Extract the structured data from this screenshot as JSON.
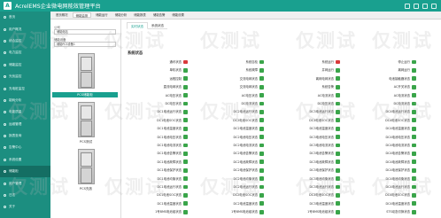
{
  "header": {
    "logo_text": "A",
    "title": "AcrelEMS企业微电网能效管理平台"
  },
  "sidebar": {
    "items": [
      {
        "label": "首页"
      },
      {
        "label": "用户概况"
      },
      {
        "label": "综合监控"
      },
      {
        "label": "电力监控"
      },
      {
        "label": "储能监控"
      },
      {
        "label": "光伏监控"
      },
      {
        "label": "充电桩监控"
      },
      {
        "label": "能耗分析"
      },
      {
        "label": "电能质量"
      },
      {
        "label": "运维管理"
      },
      {
        "label": "报表查询"
      },
      {
        "label": "告警中心"
      },
      {
        "label": "系统设置"
      },
      {
        "label": "储能柜",
        "active": true
      },
      {
        "label": "用户管理"
      },
      {
        "label": "日志"
      },
      {
        "label": "关于"
      }
    ]
  },
  "toolbar": {
    "tabs": [
      {
        "label": "首页概况"
      },
      {
        "label": "储能监测"
      },
      {
        "label": "储能运行"
      },
      {
        "label": "储能分析"
      },
      {
        "label": "储能报表"
      },
      {
        "label": "储能告警"
      },
      {
        "label": "储能设置"
      }
    ]
  },
  "tree": {
    "label1": "公司",
    "value1": "储能电站",
    "label2": "储能设备",
    "value2": "储能PCS设备1",
    "cabinets": [
      "PCS储能柜",
      "PCS测试",
      "PCS充放"
    ]
  },
  "subtabs": [
    "实时状态",
    "系统状态"
  ],
  "section_title": "系统状态",
  "status_rows": [
    [
      {
        "label": "通讯状态",
        "color": "red"
      },
      {
        "label": "系统自检",
        "color": "green"
      },
      {
        "label": "系统运行",
        "color": "red"
      },
      {
        "label": "停止运行",
        "color": "green"
      }
    ],
    [
      {
        "label": "单机状态",
        "color": "green"
      },
      {
        "label": "系统故障",
        "color": "green"
      },
      {
        "label": "并网运行",
        "color": "green"
      },
      {
        "label": "离网运行",
        "color": "green"
      }
    ],
    [
      {
        "label": "远程控制",
        "color": "green"
      },
      {
        "label": "交流电网状态",
        "color": "green"
      },
      {
        "label": "离网电网状态",
        "color": "green"
      },
      {
        "label": "电池接触器状态",
        "color": "green"
      }
    ],
    [
      {
        "label": "直流电网状态",
        "color": "green"
      },
      {
        "label": "交流电网状态",
        "color": "green"
      },
      {
        "label": "系统告警",
        "color": "green"
      },
      {
        "label": "AC开关状态",
        "color": "green"
      }
    ],
    [
      {
        "label": "AC电压状态",
        "color": "green"
      },
      {
        "label": "AC电压状态",
        "color": "green"
      },
      {
        "label": "AC电流状态",
        "color": "green"
      },
      {
        "label": "AC电流状态",
        "color": "green"
      }
    ],
    [
      {
        "label": "DC电压状态",
        "color": "green"
      },
      {
        "label": "DC电流状态",
        "color": "green"
      },
      {
        "label": "DC电压状态",
        "color": "green"
      },
      {
        "label": "DC电流状态",
        "color": "green"
      }
    ],
    [
      {
        "label": "DC1电池运行状态",
        "color": "green"
      },
      {
        "label": "DC2电池运行状态",
        "color": "green"
      },
      {
        "label": "DC3电池运行状态",
        "color": "green"
      },
      {
        "label": "DC4电池运行状态",
        "color": "green"
      }
    ],
    [
      {
        "label": "DC1电池SOC状态",
        "color": "green"
      },
      {
        "label": "DC2电池SOC状态",
        "color": "green"
      },
      {
        "label": "DC3电池SOC状态",
        "color": "green"
      },
      {
        "label": "DC4电池SOC状态",
        "color": "green"
      }
    ],
    [
      {
        "label": "DC1电池温度状态",
        "color": "green"
      },
      {
        "label": "DC2电池温度状态",
        "color": "green"
      },
      {
        "label": "DC3电池温度状态",
        "color": "green"
      },
      {
        "label": "DC4电池温度状态",
        "color": "green"
      }
    ],
    [
      {
        "label": "DC1电池电压状态",
        "color": "green"
      },
      {
        "label": "DC2电池电压状态",
        "color": "green"
      },
      {
        "label": "DC3电池电压状态",
        "color": "green"
      },
      {
        "label": "DC4电池电压状态",
        "color": "green"
      }
    ],
    [
      {
        "label": "DC1电池电流状态",
        "color": "green"
      },
      {
        "label": "DC2电池电流状态",
        "color": "green"
      },
      {
        "label": "DC3电池电流状态",
        "color": "green"
      },
      {
        "label": "DC4电池电流状态",
        "color": "green"
      }
    ],
    [
      {
        "label": "DC1电池告警状态",
        "color": "green"
      },
      {
        "label": "DC2电池告警状态",
        "color": "green"
      },
      {
        "label": "DC3电池告警状态",
        "color": "green"
      },
      {
        "label": "DC4电池告警状态",
        "color": "green"
      }
    ],
    [
      {
        "label": "DC1电池故障状态",
        "color": "green"
      },
      {
        "label": "DC2电池故障状态",
        "color": "green"
      },
      {
        "label": "DC3电池故障状态",
        "color": "green"
      },
      {
        "label": "DC4电池故障状态",
        "color": "green"
      }
    ],
    [
      {
        "label": "DC1电池保护状态",
        "color": "green"
      },
      {
        "label": "DC2电池保护状态",
        "color": "green"
      },
      {
        "label": "DC3电池保护状态",
        "color": "green"
      },
      {
        "label": "DC4电池保护状态",
        "color": "green"
      }
    ],
    [
      {
        "label": "DC1电池均衡状态",
        "color": "green"
      },
      {
        "label": "DC2电池均衡状态",
        "color": "green"
      },
      {
        "label": "DC3电池均衡状态",
        "color": "green"
      },
      {
        "label": "DC4电池均衡状态",
        "color": "green"
      }
    ],
    [
      {
        "label": "DC1电池运行状态",
        "color": "green"
      },
      {
        "label": "DC2电池运行状态",
        "color": "green"
      },
      {
        "label": "DC3电池运行状态",
        "color": "green"
      },
      {
        "label": "DC4电池运行状态",
        "color": "green"
      }
    ],
    [
      {
        "label": "DC1电池SOC状态",
        "color": "green"
      },
      {
        "label": "DC2电池SOC状态",
        "color": "green"
      },
      {
        "label": "DC3电池SOC状态",
        "color": "green"
      },
      {
        "label": "DC4电池SOC状态",
        "color": "green"
      }
    ],
    [
      {
        "label": "DC1电池温度状态",
        "color": "green"
      },
      {
        "label": "DC2电池温度状态",
        "color": "green"
      },
      {
        "label": "DC3电池温度状态",
        "color": "green"
      },
      {
        "label": "DC4电池温度状态",
        "color": "green"
      }
    ],
    [
      {
        "label": "1号BMS电池组状态",
        "color": "green"
      },
      {
        "label": "1号BMS电池组状态",
        "color": "green"
      },
      {
        "label": "1号BMS电池组状态",
        "color": "green"
      },
      {
        "label": "STS动态切换状态",
        "color": "green"
      }
    ]
  ],
  "watermark": "仅测试",
  "colors": {
    "brand": "#19a08f",
    "sidebar": "#1c8e80",
    "ok": "#3aa54a",
    "alarm": "#d93a3a"
  }
}
